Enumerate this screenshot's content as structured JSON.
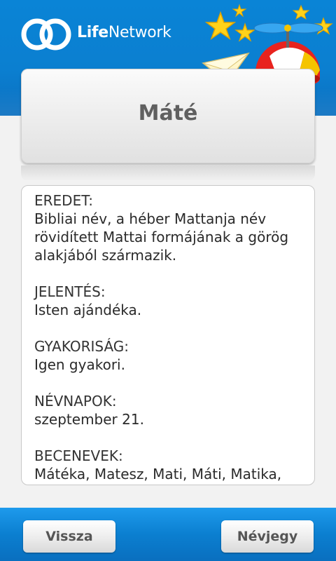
{
  "header": {
    "brand_bold": "Life",
    "brand_light": "Network"
  },
  "name_card": {
    "title": "Máté"
  },
  "info": {
    "sections": [
      {
        "label": "EREDET:",
        "body": "Bibliai név, a héber Mattanja név rövidített Mattai formájának a görög alakjából származik."
      },
      {
        "label": "JELENTÉS:",
        "body": "Isten ajándéka."
      },
      {
        "label": "GYAKORISÁG:",
        "body": "Igen gyakori."
      },
      {
        "label": "NÉVNAPOK:",
        "body": "szeptember 21."
      },
      {
        "label": "BECENEVEK:",
        "body": "Mátéka, Matesz, Mati, Máti, Matika,"
      }
    ]
  },
  "footer": {
    "back_label": "Vissza",
    "about_label": "Névjegy"
  },
  "colors": {
    "header_blue": "#0b7fd0",
    "title_gray": "#606060"
  }
}
